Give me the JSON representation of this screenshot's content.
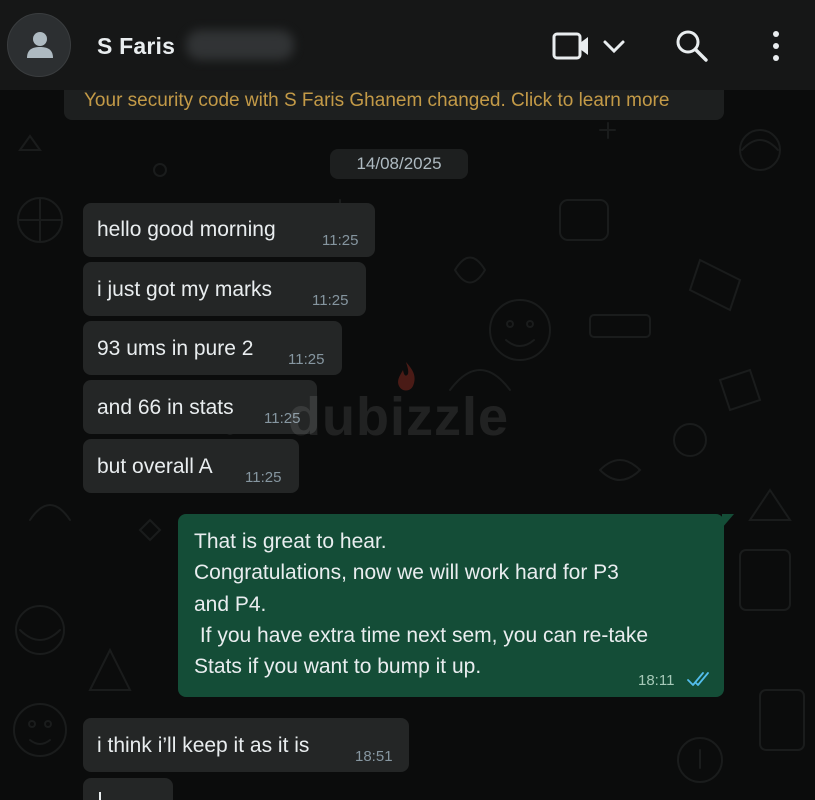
{
  "header": {
    "contact_name": "S Faris",
    "icons": [
      "avatar-icon",
      "video-call-icon",
      "chevron-down-icon",
      "search-icon",
      "more-vert-icon"
    ]
  },
  "chat": {
    "security_notice": "Your security code with S Faris Ghanem changed. Click to learn more",
    "date_separator": "14/08/2025",
    "messages": [
      {
        "direction": "incoming",
        "text": "hello good morning",
        "time": "11:25"
      },
      {
        "direction": "incoming",
        "text": "i just got my marks",
        "time": "11:25"
      },
      {
        "direction": "incoming",
        "text": "93 ums in pure 2",
        "time": "11:25"
      },
      {
        "direction": "incoming",
        "text": "and 66 in stats",
        "time": "11:25"
      },
      {
        "direction": "incoming",
        "text": "but overall A",
        "time": "11:25"
      },
      {
        "direction": "outgoing",
        "lines": [
          "That is great to hear.",
          "Congratulations, now we will work hard for P3",
          "and P4.",
          " If you have extra time next sem, you can re-take",
          "Stats if you want to bump it up."
        ],
        "time": "18:11",
        "status": "read"
      },
      {
        "direction": "incoming",
        "text": "i think i’ll keep it as it is",
        "time": "18:51"
      }
    ],
    "watermark": "dubizzle"
  },
  "colors": {
    "header_bg": "#161717",
    "chat_bg": "#0b0c0c",
    "incoming_bubble": "#242626",
    "outgoing_bubble": "#144d37",
    "read_tick": "#53bdeb"
  }
}
